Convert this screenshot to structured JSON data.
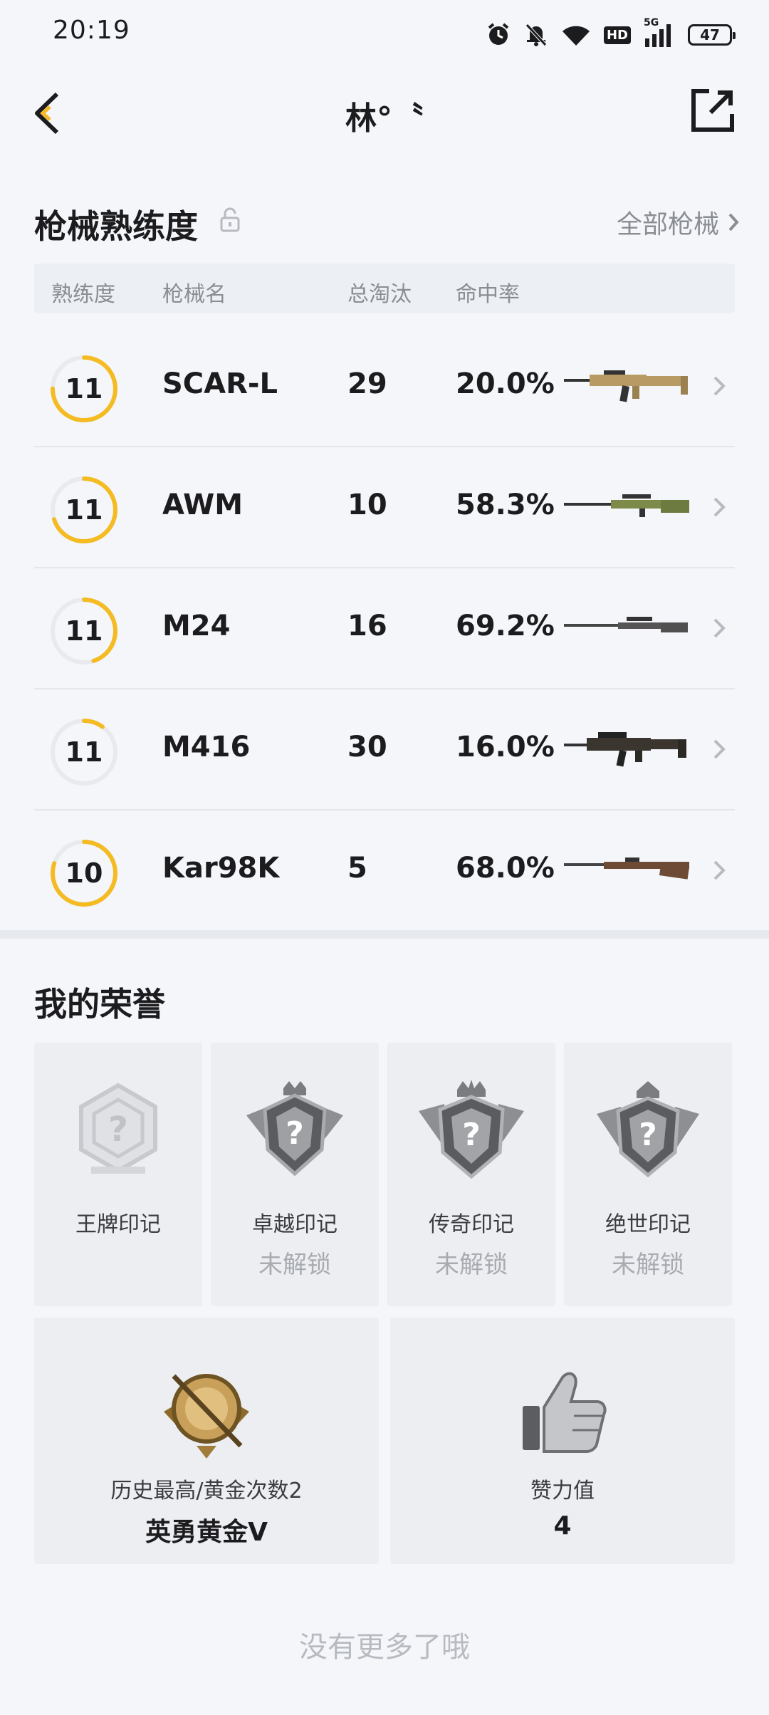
{
  "status_bar": {
    "time": "20:19",
    "hd": "HD",
    "network": "5G",
    "battery": "47"
  },
  "header": {
    "title": "林°〝"
  },
  "weapons_section": {
    "title": "枪械熟练度",
    "all_link": "全部枪械",
    "columns": [
      "熟练度",
      "枪械名",
      "总淘汰",
      "命中率"
    ],
    "rows": [
      {
        "level": "11",
        "progress": 0.75,
        "name": "SCAR-L",
        "kills": "29",
        "accuracy": "20.0%",
        "weapon_icon": "scar-l-rifle"
      },
      {
        "level": "11",
        "progress": 0.7,
        "name": "AWM",
        "kills": "10",
        "accuracy": "58.3%",
        "weapon_icon": "awm-rifle"
      },
      {
        "level": "11",
        "progress": 0.45,
        "name": "M24",
        "kills": "16",
        "accuracy": "69.2%",
        "weapon_icon": "m24-rifle"
      },
      {
        "level": "11",
        "progress": 0.1,
        "name": "M416",
        "kills": "30",
        "accuracy": "16.0%",
        "weapon_icon": "m416-rifle"
      },
      {
        "level": "10",
        "progress": 0.8,
        "name": "Kar98K",
        "kills": "5",
        "accuracy": "68.0%",
        "weapon_icon": "kar98k-rifle"
      }
    ]
  },
  "honors_section": {
    "title": "我的荣誉",
    "badges": [
      {
        "name": "王牌印记",
        "status": ""
      },
      {
        "name": "卓越印记",
        "status": "未解锁"
      },
      {
        "name": "传奇印记",
        "status": "未解锁"
      },
      {
        "name": "绝世印记",
        "status": "未解锁"
      }
    ],
    "rank_card": {
      "label": "历史最高/黄金次数2",
      "value": "英勇黄金V"
    },
    "like_card": {
      "label": "赞力值",
      "value": "4"
    }
  },
  "footer": {
    "text": "没有更多了哦"
  },
  "colors": {
    "ring": "#f4bb22",
    "ring_track": "#e8eaee",
    "accent_text": "#1c1c1e"
  }
}
